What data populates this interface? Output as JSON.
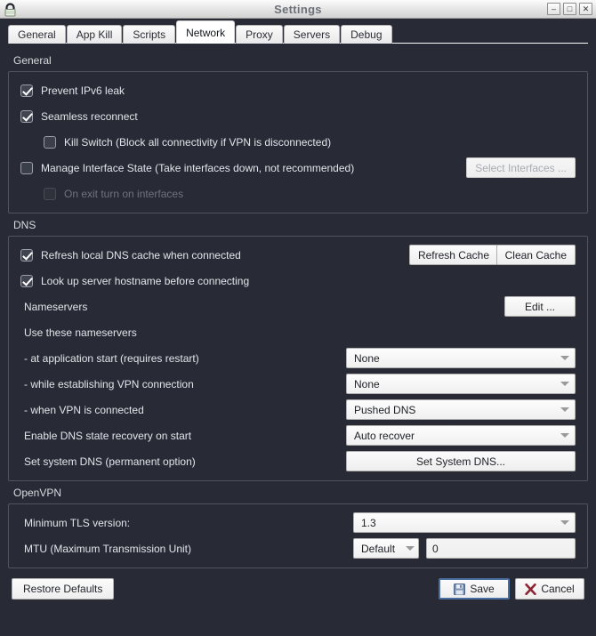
{
  "window": {
    "title": "Settings",
    "app_icon": "padlock-icon",
    "controls": {
      "minimize": "–",
      "maximize": "□",
      "close": "✕"
    }
  },
  "tabs": [
    {
      "label": "General",
      "active": false
    },
    {
      "label": "App Kill",
      "active": false
    },
    {
      "label": "Scripts",
      "active": false
    },
    {
      "label": "Network",
      "active": true
    },
    {
      "label": "Proxy",
      "active": false
    },
    {
      "label": "Servers",
      "active": false
    },
    {
      "label": "Debug",
      "active": false
    }
  ],
  "general": {
    "title": "General",
    "prevent_ipv6_leak": {
      "label": "Prevent IPv6 leak",
      "checked": true
    },
    "seamless_reconnect": {
      "label": "Seamless reconnect",
      "checked": true
    },
    "kill_switch": {
      "label": "Kill Switch (Block all connectivity if VPN is disconnected)",
      "checked": false
    },
    "manage_interface_state": {
      "label": "Manage Interface State (Take interfaces down, not recommended)",
      "checked": false
    },
    "on_exit_turn_on_interfaces": {
      "label": "On exit turn on interfaces",
      "checked": false,
      "disabled": true
    },
    "select_interfaces_button": {
      "label": "Select Interfaces ...",
      "disabled": true
    }
  },
  "dns": {
    "title": "DNS",
    "refresh_local_cache": {
      "label": "Refresh local DNS cache when connected",
      "checked": true
    },
    "lookup_hostname": {
      "label": "Look up server hostname before connecting",
      "checked": true
    },
    "refresh_cache_button": "Refresh Cache",
    "clean_cache_button": "Clean Cache",
    "nameservers_label": "Nameservers",
    "nameservers_edit_button": "Edit ...",
    "use_these_nameservers_label": "Use these nameservers",
    "at_application_start": {
      "label": "- at application start (requires restart)",
      "value": "None"
    },
    "while_establishing": {
      "label": "- while establishing VPN connection",
      "value": "None"
    },
    "when_connected": {
      "label": "- when VPN is connected",
      "value": "Pushed DNS"
    },
    "state_recovery": {
      "label": "Enable DNS state recovery on start",
      "value": "Auto recover"
    },
    "set_system_dns": {
      "label": "Set system DNS (permanent option)",
      "button": "Set System DNS..."
    }
  },
  "openvpn": {
    "title": "OpenVPN",
    "min_tls": {
      "label": "Minimum TLS version:",
      "value": "1.3"
    },
    "mtu": {
      "label": "MTU (Maximum Transmission Unit)",
      "mode": "Default",
      "value": "0"
    }
  },
  "footer": {
    "restore_defaults": "Restore Defaults",
    "save": "Save",
    "cancel": "Cancel",
    "save_icon": "floppy-disk-icon",
    "cancel_icon": "red-x-icon",
    "save_border_color": "#4a6fa0",
    "cancel_icon_color": "#8c2533"
  }
}
